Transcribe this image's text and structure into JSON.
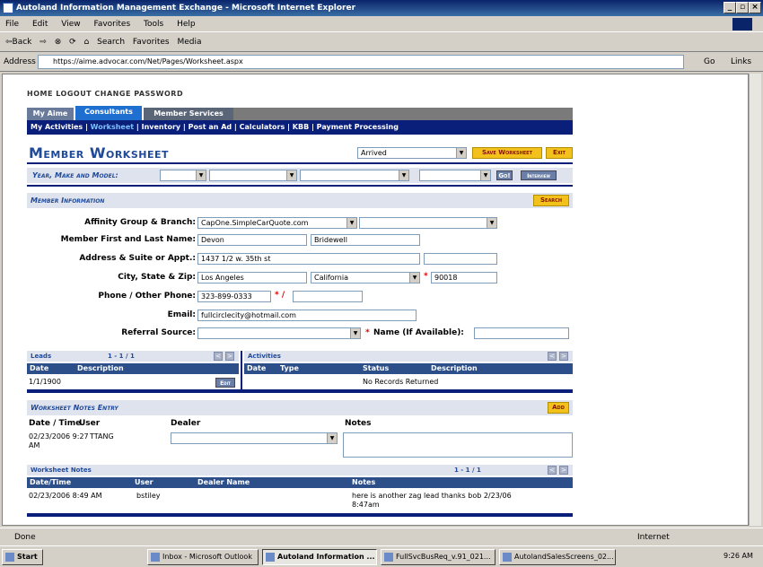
{
  "window": {
    "title": "Autoland Information Management Exchange - Microsoft Internet Explorer"
  },
  "menu": [
    "File",
    "Edit",
    "View",
    "Favorites",
    "Tools",
    "Help"
  ],
  "toolbar": {
    "back": "⇦Back",
    "search": "Search",
    "favorites": "Favorites",
    "media": "Media"
  },
  "address": {
    "label": "Address",
    "url": "https://aime.advocar.com/Net/Pages/Worksheet.aspx",
    "go": "Go",
    "links": "Links"
  },
  "topnav": "HOME  LOGOUT  CHANGE PASSWORD",
  "tabs": [
    "My Aime",
    "Consultants",
    "Member Services"
  ],
  "subnav": {
    "items": [
      "My Activities",
      "Worksheet",
      "Inventory",
      "Post an Ad",
      "Calculators",
      "KBB",
      "Payment Processing"
    ]
  },
  "page": {
    "title": "Member Worksheet",
    "status": "Arrived",
    "save": "Save Worksheet",
    "exit": "Exit"
  },
  "ymm": {
    "label": "Year, Make and Model:",
    "go": "Go!",
    "interview": "Interview"
  },
  "member": {
    "section": "Member Information",
    "search": "Search",
    "affinity_label": "Affinity Group & Branch:",
    "affinity": "CapOne.SimpleCarQuote.com",
    "name_label": "Member First and Last Name:",
    "first": "Devon",
    "last": "Bridewell",
    "address_label": "Address & Suite or Appt.:",
    "address": "1437 1/2 w. 35th st",
    "city_label": "City, State & Zip:",
    "city": "Los Angeles",
    "state": "California",
    "zip": "90018",
    "phone_label": "Phone / Other Phone:",
    "phone": "323-899-0333",
    "email_label": "Email:",
    "email": "fullcirclecity@hotmail.com",
    "referral_label": "Referral Source:",
    "name_if": "Name (If Available):"
  },
  "leads": {
    "title": "Leads",
    "count": "1 - 1 / 1",
    "cols": [
      "Date",
      "Description"
    ],
    "row": {
      "date": "1/1/1900",
      "edit": "Edit"
    }
  },
  "activities": {
    "title": "Activities",
    "cols": [
      "Date",
      "Type",
      "Status",
      "Description"
    ],
    "empty": "No Records Returned"
  },
  "notes_entry": {
    "title": "Worksheet Notes Entry",
    "add": "Add",
    "cols": [
      "Date / Time",
      "User",
      "Dealer",
      "Notes"
    ],
    "datetime": "02/23/2006 9:27",
    "user": "TTANG",
    "am": "AM"
  },
  "notes": {
    "title": "Worksheet Notes",
    "count": "1 - 1 / 1",
    "cols": [
      "Date/Time",
      "User",
      "Dealer Name",
      "Notes"
    ],
    "row": {
      "datetime": "02/23/2006 8:49 AM",
      "user": "bstiley",
      "note1": "here is another zag lead thanks bob 2/23/06",
      "note2": "8:47am"
    }
  },
  "status": {
    "text": "Done",
    "zone": "Internet"
  },
  "taskbar": {
    "start": "Start",
    "items": [
      "Inbox - Microsoft Outlook",
      "Autoland Information ...",
      "FullSvcBusReq_v.91_021...",
      "AutolandSalesScreens_02..."
    ],
    "time": "9:26 AM"
  },
  "colors": {
    "navy": "#0a1f7a",
    "accent_blue": "#1f4a9a",
    "button_yellow": "#f3c11b"
  }
}
